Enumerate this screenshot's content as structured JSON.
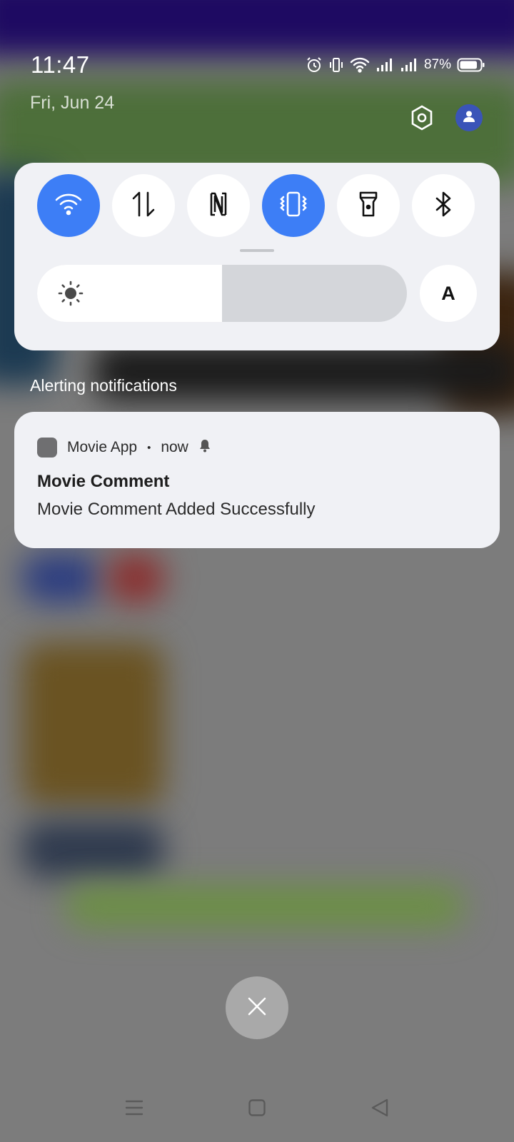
{
  "status_bar": {
    "time": "11:47",
    "battery_percent": "87%",
    "battery_level": 0.87,
    "icons": [
      "alarm-icon",
      "vibrate-icon",
      "wifi-icon",
      "signal-icon",
      "signal-icon",
      "battery-icon"
    ]
  },
  "date": "Fri, Jun 24",
  "quick_settings": {
    "tiles": [
      {
        "name": "wifi-toggle",
        "icon": "wifi-icon",
        "active": true
      },
      {
        "name": "mobile-data-toggle",
        "icon": "data-arrows-icon",
        "active": false
      },
      {
        "name": "nfc-toggle",
        "icon": "nfc-icon",
        "active": false
      },
      {
        "name": "vibrate-toggle",
        "icon": "vibrate-icon",
        "active": true
      },
      {
        "name": "flashlight-toggle",
        "icon": "flashlight-icon",
        "active": false
      },
      {
        "name": "bluetooth-toggle",
        "icon": "bluetooth-icon",
        "active": false
      }
    ],
    "brightness_level": 0.5,
    "auto_brightness_label": "A",
    "accent_color": "#3d7ef6"
  },
  "notifications": {
    "section_label": "Alerting notifications",
    "items": [
      {
        "app_name": "Movie App",
        "time": "now",
        "title": "Movie Comment",
        "body": "Movie Comment Added Successfully"
      }
    ]
  },
  "navigation": {
    "buttons": [
      "menu-icon",
      "home-icon",
      "back-icon"
    ]
  }
}
